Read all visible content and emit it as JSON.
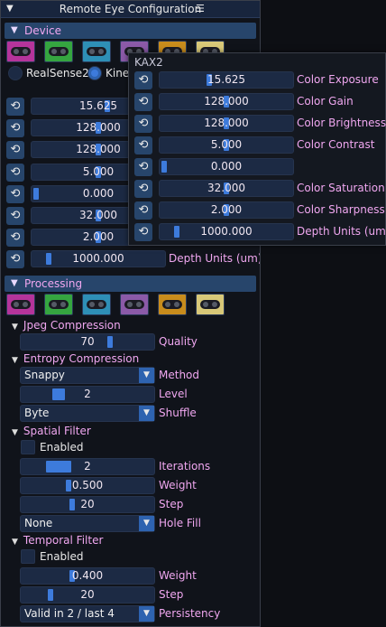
{
  "window": {
    "title": "Remote Eye Configuration",
    "collapse_icon": "triangle-down-icon",
    "menu_icon": "hamburger-icon"
  },
  "device": {
    "header": "Device",
    "swatches": [
      "#b5349b",
      "#35a540",
      "#2e8fb6",
      "#8b5aa8",
      "#c88c1c",
      "#d8c878"
    ],
    "radio_options": [
      "RealSense2",
      "Kinect"
    ],
    "selected": "Kinect",
    "sliders": [
      {
        "value": "15.625",
        "fraction": 0.57,
        "label": "Color Exposure"
      },
      {
        "value": "128.000",
        "fraction": 0.5,
        "label": "Color Gain"
      },
      {
        "value": "128.000",
        "fraction": 0.5,
        "label": "Color Brightness"
      },
      {
        "value": "5.000",
        "fraction": 0.5,
        "label": "Color Contrast"
      },
      {
        "value": "0.000",
        "fraction": 0.0,
        "label": ""
      },
      {
        "value": "32.000",
        "fraction": 0.5,
        "label": "Color Saturation"
      },
      {
        "value": "2.000",
        "fraction": 0.5,
        "label": "Color Sharpness"
      },
      {
        "value": "1000.000",
        "fraction": 0.1,
        "label": "Depth Units (um)"
      }
    ]
  },
  "popup": {
    "title": "KAX2",
    "sliders": [
      {
        "value": "15.625",
        "fraction": 0.36,
        "label": "Color Exposure"
      },
      {
        "value": "128.000",
        "fraction": 0.5,
        "label": "Color Gain"
      },
      {
        "value": "128.000",
        "fraction": 0.5,
        "label": "Color Brightness"
      },
      {
        "value": "5.000",
        "fraction": 0.5,
        "label": "Color Contrast"
      },
      {
        "value": "0.000",
        "fraction": 0.0,
        "label": ""
      },
      {
        "value": "32.000",
        "fraction": 0.5,
        "label": "Color Saturation"
      },
      {
        "value": "2.000",
        "fraction": 0.5,
        "label": "Color Sharpness"
      },
      {
        "value": "1000.000",
        "fraction": 0.1,
        "label": "Depth Units (um)"
      }
    ]
  },
  "processing": {
    "header": "Processing",
    "swatches": [
      "#b5349b",
      "#35a540",
      "#2e8fb6",
      "#8b5aa8",
      "#c88c1c",
      "#d8c878"
    ],
    "jpeg": {
      "title": "Jpeg Compression",
      "quality_value": "70",
      "quality_fraction": 0.68,
      "quality_label": "Quality"
    },
    "entropy": {
      "title": "Entropy Compression",
      "method_value": "Snappy",
      "method_label": "Method",
      "level_value": "2",
      "level_fraction": 0.25,
      "level_label": "Level",
      "shuffle_value": "Byte",
      "shuffle_label": "Shuffle"
    },
    "spatial": {
      "title": "Spatial Filter",
      "enabled_label": "Enabled",
      "iterations_value": "2",
      "iterations_fraction": 0.22,
      "iterations_label": "Iterations",
      "weight_value": "0.500",
      "weight_fraction": 0.35,
      "weight_label": "Weight",
      "step_value": "20",
      "step_fraction": 0.38,
      "step_label": "Step",
      "holefill_value": "None",
      "holefill_label": "Hole Fill"
    },
    "temporal": {
      "title": "Temporal Filter",
      "enabled_label": "Enabled",
      "weight_value": "0.400",
      "weight_fraction": 0.38,
      "weight_label": "Weight",
      "step_value": "20",
      "step_fraction": 0.2,
      "step_label": "Step",
      "persistency_value": "Valid in 2 / last 4",
      "persistency_label": "Persistency"
    }
  },
  "icons": {
    "reset": "reset-icon",
    "dropdown": "triangle-down-icon"
  }
}
